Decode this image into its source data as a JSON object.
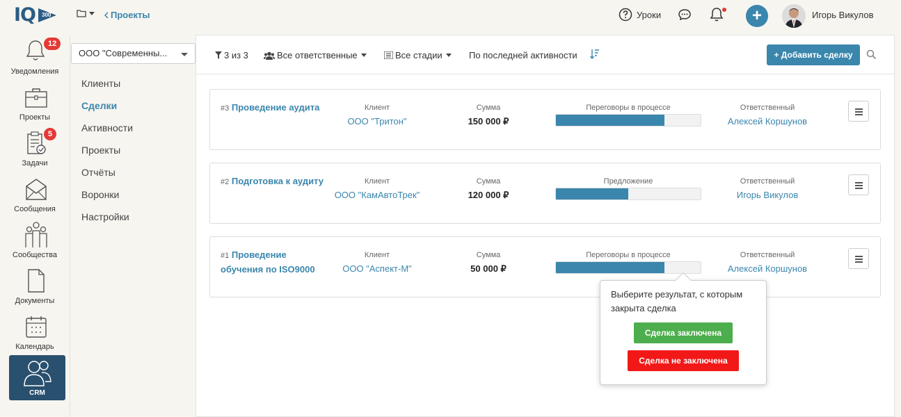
{
  "header": {
    "logo_text": "IQ",
    "logo_badge": "300",
    "back_link": "Проекты",
    "lessons_label": "Уроки",
    "user_name": "Игорь Викулов"
  },
  "leftnav": {
    "items": [
      {
        "label": "Уведомления",
        "badge": "12"
      },
      {
        "label": "Проекты",
        "badge": ""
      },
      {
        "label": "Задачи",
        "badge": "5"
      },
      {
        "label": "Сообщения",
        "badge": ""
      },
      {
        "label": "Сообщества",
        "badge": ""
      },
      {
        "label": "Документы",
        "badge": ""
      },
      {
        "label": "Календарь",
        "badge": ""
      },
      {
        "label": "CRM",
        "badge": ""
      }
    ]
  },
  "subnav": {
    "company": "ООО \"Современны...",
    "items": [
      {
        "label": "Клиенты",
        "active": false
      },
      {
        "label": "Сделки",
        "active": true
      },
      {
        "label": "Активности",
        "active": false
      },
      {
        "label": "Проекты",
        "active": false
      },
      {
        "label": "Отчёты",
        "active": false
      },
      {
        "label": "Воронки",
        "active": false
      },
      {
        "label": "Настройки",
        "active": false
      }
    ]
  },
  "toolbar": {
    "filter_count": "3 из 3",
    "responsible": "Все ответственные",
    "stages": "Все стадии",
    "sort": "По последней активности",
    "add_button": "+ Добавить сделку"
  },
  "labels": {
    "client": "Клиент",
    "sum": "Сумма",
    "responsible": "Ответственный"
  },
  "deals": [
    {
      "num": "#3",
      "title": "Проведение аудита",
      "client": "ООО \"Тритон\"",
      "sum": "150 000 ₽",
      "stage": "Переговоры в процессе",
      "progress": 0.75,
      "responsible": "Алексей Коршунов"
    },
    {
      "num": "#2",
      "title": "Подготовка к аудиту",
      "client": "ООО \"КамАвтоТрек\"",
      "sum": "120 000 ₽",
      "stage": "Предложение",
      "progress": 0.5,
      "responsible": "Игорь Викулов"
    },
    {
      "num": "#1",
      "title": "Проведение обучения по ISO9000",
      "client": "ООО \"Аспект-М\"",
      "sum": "50 000 ₽",
      "stage": "Переговоры в процессе",
      "progress": 0.75,
      "responsible": "Алексей Коршунов"
    }
  ],
  "popover": {
    "text": "Выберите результат, с которым закрыта сделка",
    "won": "Сделка заключена",
    "lost": "Сделка не заключена"
  },
  "colors": {
    "accent": "#3a86ad",
    "navy": "#29506e",
    "badge": "#e53935",
    "won": "#4cae4c",
    "lost": "#f21818"
  }
}
